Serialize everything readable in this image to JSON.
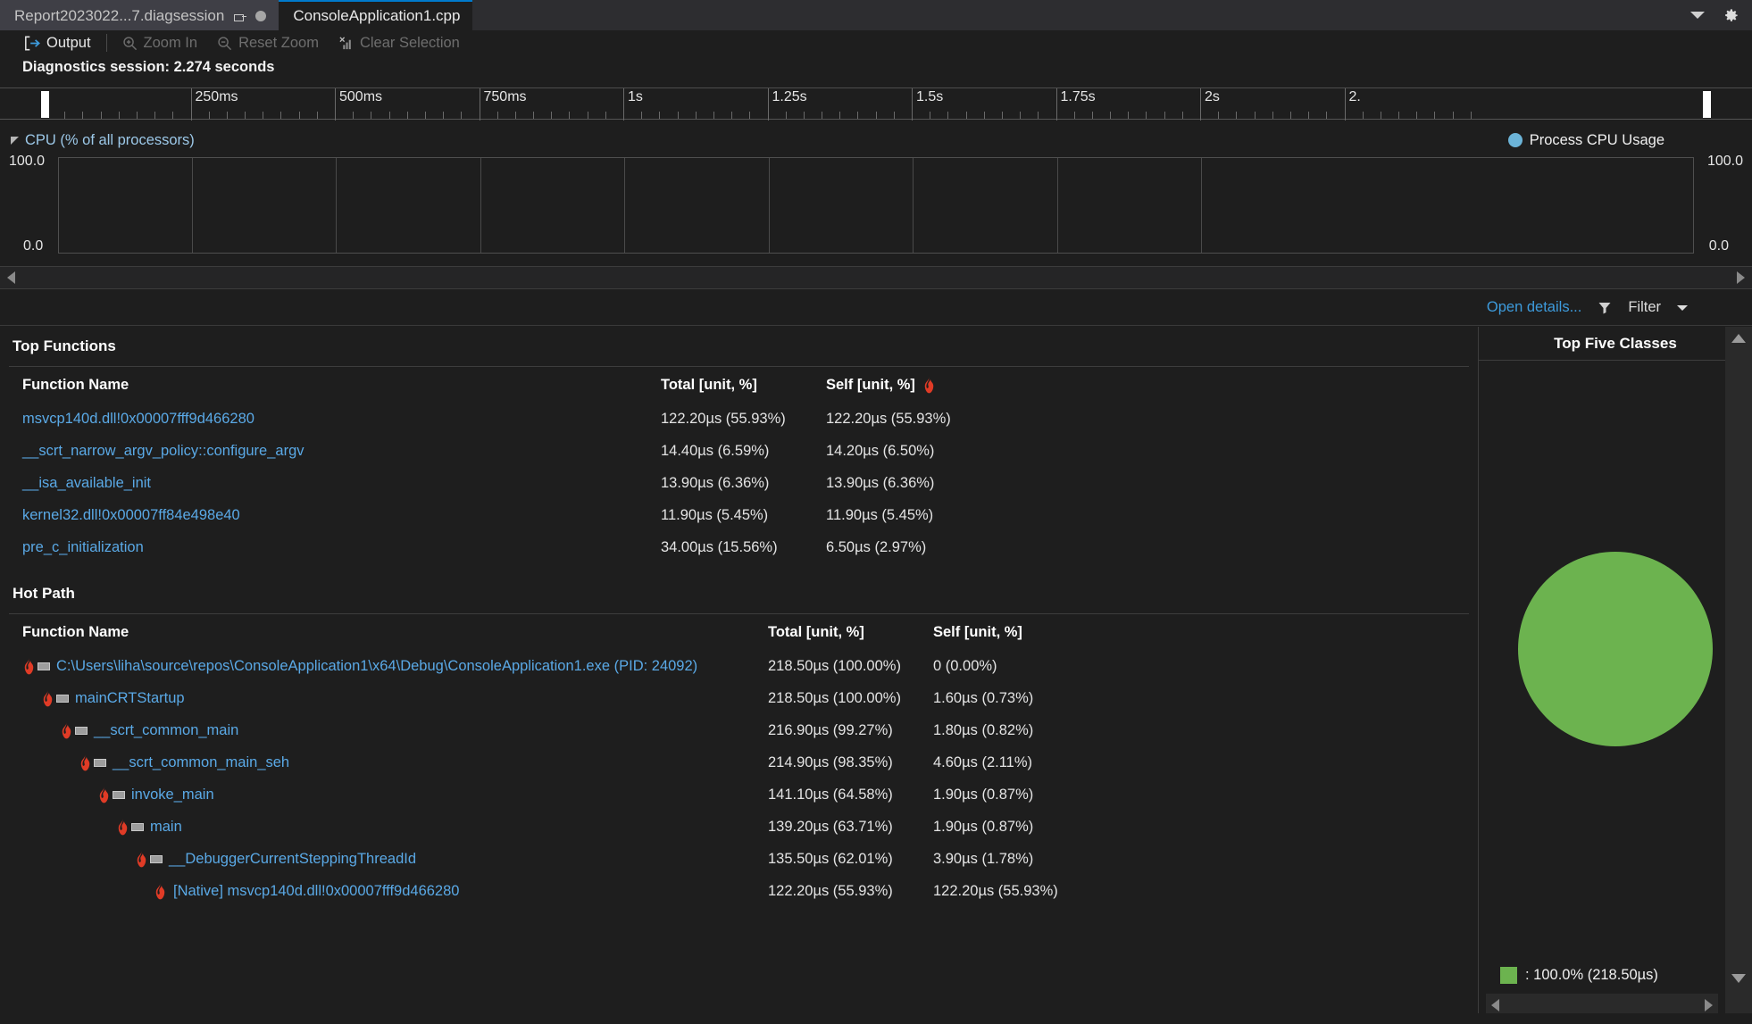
{
  "window": {
    "tabs": [
      {
        "label": "Report2023022...7.diagsession",
        "active": false,
        "pin_icon": "pin-icon",
        "status_icon": "dot-icon"
      },
      {
        "label": "ConsoleApplication1.cpp",
        "active": true
      }
    ],
    "dropdown_icon": "chevron-down-icon",
    "settings_icon": "gear-icon"
  },
  "toolbar": {
    "output_label": "Output",
    "output_icon": "output-arrow-icon",
    "zoom_in_label": "Zoom In",
    "zoom_in_icon": "zoom-in-icon",
    "reset_zoom_label": "Reset Zoom",
    "reset_zoom_icon": "zoom-out-icon",
    "clear_selection_label": "Clear Selection",
    "clear_selection_icon": "clear-chart-icon"
  },
  "session": {
    "label": "Diagnostics session: 2.274 seconds"
  },
  "ruler": {
    "ticks": [
      "250ms",
      "500ms",
      "750ms",
      "1s",
      "1.25s",
      "1.5s",
      "1.75s",
      "2s",
      "2."
    ]
  },
  "cpu_panel": {
    "title": "CPU (% of all processors)",
    "collapse_icon": "triangle-collapse-icon",
    "legend": {
      "label": "Process CPU Usage",
      "color": "#6cb4d8",
      "icon": "legend-dot-icon"
    },
    "axis_max_left": "100.0",
    "axis_min_left": "0.0",
    "axis_max_right": "100.0",
    "axis_min_right": "0.0"
  },
  "actions": {
    "open_details_label": "Open details...",
    "filter_label": "Filter",
    "filter_icon": "funnel-icon",
    "caret_icon": "caret-down-icon"
  },
  "top_functions": {
    "title": "Top Functions",
    "columns": [
      "Function Name",
      "Total [unit, %]",
      "Self [unit, %]"
    ],
    "self_header_icon": "flame-icon",
    "rows": [
      {
        "name": "msvcp140d.dll!0x00007fff9d466280",
        "total": "122.20µs (55.93%)",
        "self": "122.20µs (55.93%)"
      },
      {
        "name": "__scrt_narrow_argv_policy::configure_argv",
        "total": "14.40µs (6.59%)",
        "self": "14.20µs (6.50%)"
      },
      {
        "name": "__isa_available_init",
        "total": "13.90µs (6.36%)",
        "self": "13.90µs (6.36%)"
      },
      {
        "name": "kernel32.dll!0x00007ff84e498e40",
        "total": "11.90µs (5.45%)",
        "self": "11.90µs (5.45%)"
      },
      {
        "name": "pre_c_initialization",
        "total": "34.00µs (15.56%)",
        "self": "6.50µs (2.97%)"
      }
    ]
  },
  "hot_path": {
    "title": "Hot Path",
    "columns": [
      "Function Name",
      "Total [unit, %]",
      "Self [unit, %]"
    ],
    "rows": [
      {
        "name": "C:\\Users\\liha\\source\\repos\\ConsoleApplication1\\x64\\Debug\\ConsoleApplication1.exe (PID: 24092)",
        "total": "218.50µs (100.00%)",
        "self": "0 (0.00%)",
        "depth": 0,
        "icon": "flame-function-icon"
      },
      {
        "name": "mainCRTStartup",
        "total": "218.50µs (100.00%)",
        "self": "1.60µs (0.73%)",
        "depth": 1,
        "icon": "flame-function-icon"
      },
      {
        "name": "__scrt_common_main",
        "total": "216.90µs (99.27%)",
        "self": "1.80µs (0.82%)",
        "depth": 2,
        "icon": "flame-function-icon"
      },
      {
        "name": "__scrt_common_main_seh",
        "total": "214.90µs (98.35%)",
        "self": "4.60µs (2.11%)",
        "depth": 3,
        "icon": "flame-function-icon"
      },
      {
        "name": "invoke_main",
        "total": "141.10µs (64.58%)",
        "self": "1.90µs (0.87%)",
        "depth": 4,
        "icon": "flame-function-icon"
      },
      {
        "name": "main",
        "total": "139.20µs (63.71%)",
        "self": "1.90µs (0.87%)",
        "depth": 5,
        "icon": "flame-function-icon"
      },
      {
        "name": "__DebuggerCurrentSteppingThreadId",
        "total": "135.50µs (62.01%)",
        "self": "3.90µs (1.78%)",
        "depth": 6,
        "icon": "flame-function-icon"
      },
      {
        "name": "[Native] msvcp140d.dll!0x00007fff9d466280",
        "total": "122.20µs (55.93%)",
        "self": "122.20µs (55.93%)",
        "depth": 7,
        "icon": "flame-icon"
      }
    ]
  },
  "top_five_classes": {
    "title": "Top Five Classes",
    "legend_entry": ": 100.0% (218.50µs)",
    "slice_color": "#6cb34f"
  },
  "chart_data": {
    "type": "pie",
    "title": "Top Five Classes",
    "categories": [
      ""
    ],
    "values": [
      100.0
    ],
    "labels": [
      ": 100.0% (218.50µs)"
    ],
    "colors": [
      "#6cb34f"
    ],
    "legend_position": "bottom-left",
    "units": "µs",
    "total": "218.50µs"
  }
}
